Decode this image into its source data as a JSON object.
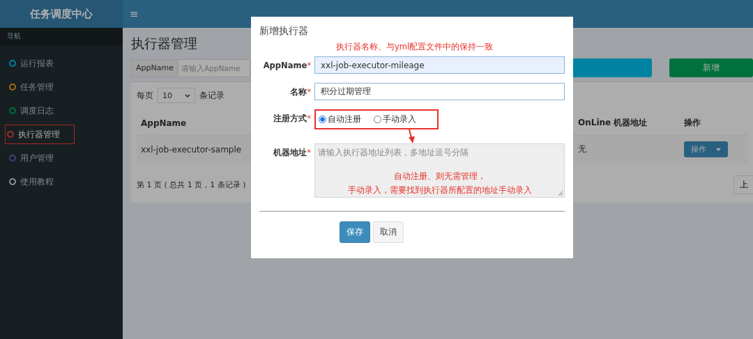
{
  "header": {
    "logo": "任务调度中心",
    "menu_toggle": "≡"
  },
  "sidebar": {
    "heading": "导航",
    "items": [
      {
        "label": "运行报表",
        "color": "#0083a3",
        "selected": false,
        "annotated": false
      },
      {
        "label": "任务管理",
        "color": "#a56a0c",
        "selected": false,
        "annotated": false
      },
      {
        "label": "调度日志",
        "color": "#00713d",
        "selected": false,
        "annotated": false
      },
      {
        "label": "执行器管理",
        "color": "#963327",
        "selected": true,
        "annotated": true
      },
      {
        "label": "用户管理",
        "color": "#413e72",
        "selected": false,
        "annotated": false
      },
      {
        "label": "使用教程",
        "color": "#8f9197",
        "selected": false,
        "annotated": false
      }
    ]
  },
  "page": {
    "title": "执行器管理",
    "search": {
      "label": "AppName",
      "placeholder": "请输入AppName"
    },
    "add_button": "新增",
    "page_size": {
      "before": "每页",
      "value": "10",
      "after": "条记录"
    },
    "table": {
      "columns": [
        "AppName",
        "OnLine 机器地址",
        "操作"
      ],
      "rows": [
        {
          "cells": [
            "xxl-job-executor-sample",
            "无"
          ],
          "action": "操作"
        }
      ]
    },
    "pagination_info": "第 1 页 ( 总共 1 页，1 条记录 )",
    "prev_button": "上"
  },
  "dialog": {
    "title": "新增执行器",
    "note": "执行器名称、与yml配置文件中的保持一致",
    "fields": [
      {
        "kind": "text",
        "label": "AppName",
        "asterisk": "*",
        "value": "xxl-job-executor-mileage",
        "autofilled": true
      },
      {
        "kind": "text",
        "label": "名称",
        "asterisk": "*",
        "value": "积分过期管理",
        "autofilled": false
      },
      {
        "kind": "radio",
        "label": "注册方式",
        "asterisk": "*",
        "annotated": true,
        "options": [
          {
            "label": "自动注册",
            "selected": true
          },
          {
            "label": "手动录入",
            "selected": false
          }
        ]
      },
      {
        "kind": "textarea",
        "label": "机器地址",
        "asterisk": "*",
        "placeholder": "请输入执行器地址列表，多地址逗号分隔",
        "disabled": true
      }
    ],
    "callout": [
      "自动注册、则无需管理，",
      "手动录入，需要找到执行器所配置的地址手动录入"
    ],
    "buttons": [
      {
        "label": "保存",
        "primary": true
      },
      {
        "label": "取消",
        "primary": false
      }
    ]
  }
}
